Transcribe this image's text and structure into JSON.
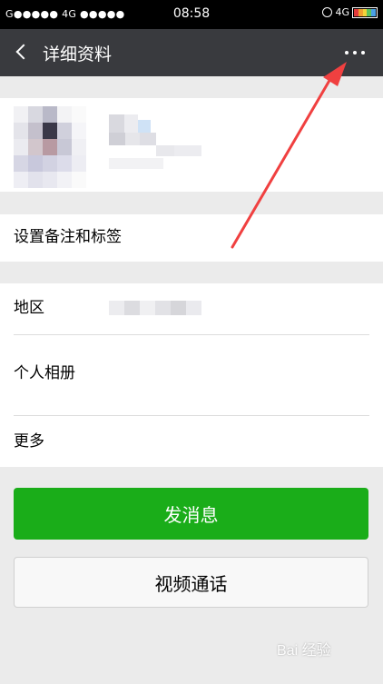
{
  "status_bar": {
    "carrier": "G●●●●● 4G ●●●●●",
    "time": "08:58",
    "network": "4G"
  },
  "nav": {
    "title": "详细资料"
  },
  "rows": {
    "remark": "设置备注和标签",
    "region": "地区",
    "album": "个人相册",
    "more": "更多"
  },
  "buttons": {
    "send_message": "发消息",
    "video_call": "视频通话"
  },
  "colors": {
    "navbar": "#393a3e",
    "primary_button": "#1aad19",
    "annotation_arrow": "#f04040"
  },
  "icons": {
    "back": "chevron-left-icon",
    "more": "ellipsis-icon"
  },
  "watermark": "Bai 经验"
}
